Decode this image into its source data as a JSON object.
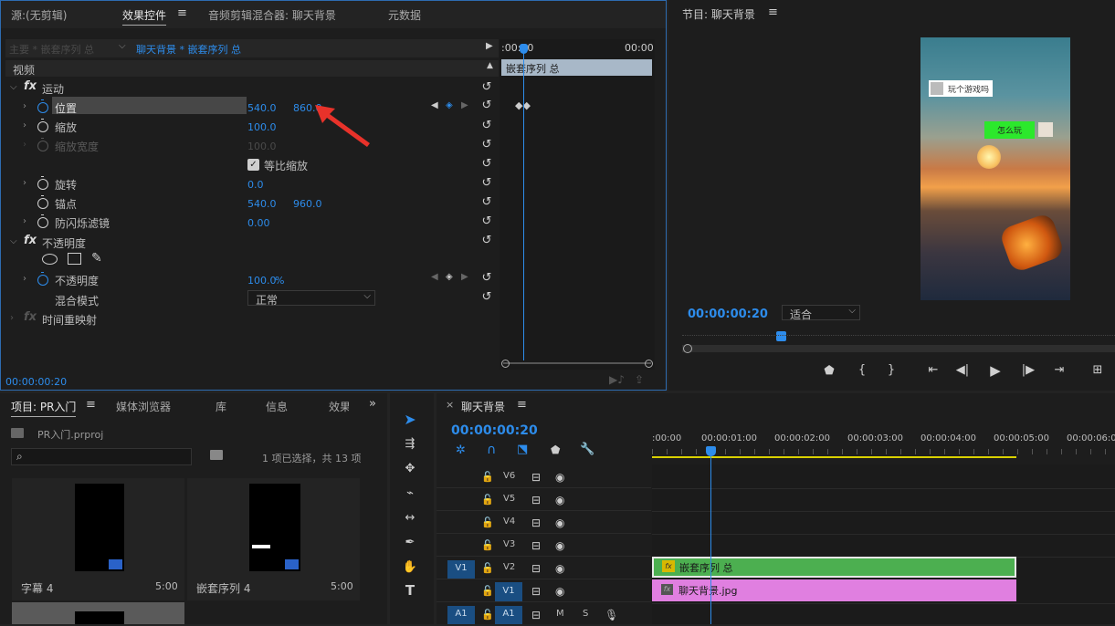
{
  "source_panel": {
    "tabs": [
      "源:(无剪辑)",
      "效果控件",
      "音频剪辑混合器: 聊天背景",
      "元数据"
    ],
    "menu_icon": "hamburger-icon",
    "master_label": "主要 * 嵌套序列 总",
    "clip_label": "聊天背景 * 嵌套序列 总",
    "section_video": "视频",
    "tc_start": ":00:00",
    "tc_end": "00:00",
    "clip_bar": "嵌套序列 总",
    "footer_time": "00:00:00:20"
  },
  "effects": {
    "motion": "运动",
    "position": {
      "label": "位置",
      "x": "540.0",
      "y": "860.0"
    },
    "scale": {
      "label": "缩放",
      "value": "100.0"
    },
    "scale_width": {
      "label": "缩放宽度",
      "value": "100.0"
    },
    "uniform": {
      "label": "等比缩放",
      "checked": true
    },
    "rotation": {
      "label": "旋转",
      "value": "0.0"
    },
    "anchor": {
      "label": "锚点",
      "x": "540.0",
      "y": "960.0"
    },
    "flicker": {
      "label": "防闪烁滤镜",
      "value": "0.00"
    },
    "opacity_section": "不透明度",
    "opacity": {
      "label": "不透明度",
      "value": "100.0",
      "unit": "%"
    },
    "blend": {
      "label": "混合模式",
      "value": "正常"
    },
    "time_remap": "时间重映射",
    "fx_symbol": "fx"
  },
  "program": {
    "title": "节目: 聊天背景",
    "bubble1": "玩个游戏吗",
    "bubble2": "怎么玩",
    "timecode": "00:00:00:20",
    "fit": "适合"
  },
  "project": {
    "tabs": [
      "项目: PR入门",
      "媒体浏览器",
      "库",
      "信息",
      "效果"
    ],
    "file": "PR入门.prproj",
    "search_placeholder": "",
    "status": "1 项已选择，共 13 项",
    "items": [
      {
        "name": "字幕 4",
        "duration": "5:00"
      },
      {
        "name": "嵌套序列 4",
        "duration": "5:00"
      }
    ]
  },
  "timeline": {
    "title": "聊天背景",
    "timecode": "00:00:00:20",
    "ruler": [
      ":00:00",
      "00:00:01:00",
      "00:00:02:00",
      "00:00:03:00",
      "00:00:04:00",
      "00:00:05:00",
      "00:00:06:00"
    ],
    "tracks": [
      "V6",
      "V5",
      "V4",
      "V3",
      "V2",
      "V1",
      "A1"
    ],
    "src_v1": "V1",
    "src_a1": "A1",
    "mute": "M",
    "solo": "S",
    "clip_v2": "嵌套序列 总",
    "clip_v1": "聊天背景.jpg"
  },
  "colors": {
    "accent": "#2d8ceb",
    "clip_green": "#4caf50",
    "clip_pink": "#e07fe0",
    "clip_bar": "#a8b8c8",
    "work_area": "#d9d100"
  }
}
